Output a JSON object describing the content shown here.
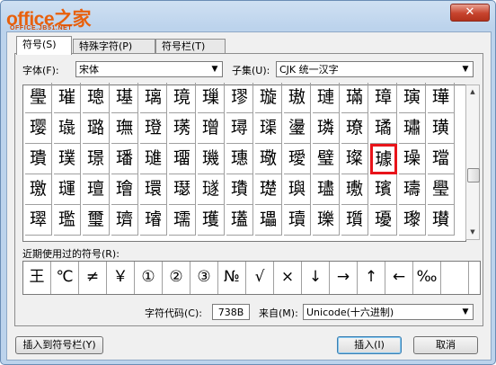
{
  "window": {
    "logo": "office之家",
    "logo_sub": "OFFICE.JB51.NET",
    "close_glyph": "✕"
  },
  "tabs": [
    {
      "label": "符号(S)",
      "active": true
    },
    {
      "label": "特殊字符(P)",
      "active": false
    },
    {
      "label": "符号栏(T)",
      "active": false
    }
  ],
  "font": {
    "label": "字体(F):",
    "value": "宋体"
  },
  "subset": {
    "label": "子集(U):",
    "value": "CJK 统一汉字"
  },
  "grid": {
    "rows": [
      [
        "璺",
        "璀",
        "璁",
        "璂",
        "璃",
        "璄",
        "璅",
        "璆",
        "璇",
        "璈",
        "璉",
        "璊",
        "璋",
        "璌",
        "璍"
      ],
      [
        "璎",
        "璏",
        "璐",
        "璑",
        "璒",
        "璓",
        "璔",
        "璕",
        "璖",
        "璗",
        "璘",
        "璙",
        "璚",
        "璛",
        "璜"
      ],
      [
        "璝",
        "璞",
        "璟",
        "璠",
        "璡",
        "璢",
        "璣",
        "璤",
        "璥",
        "璦",
        "璧",
        "璨",
        "璩",
        "璪",
        "璫"
      ],
      [
        "璬",
        "璭",
        "璮",
        "璯",
        "環",
        "璱",
        "璲",
        "璳",
        "璴",
        "璵",
        "璶",
        "璷",
        "璸",
        "璹",
        "璺"
      ],
      [
        "璻",
        "璼",
        "璽",
        "璾",
        "璿",
        "瓀",
        "瓁",
        "瓂",
        "瓃",
        "瓄",
        "瓅",
        "瓆",
        "瓇",
        "瓈",
        "瓉"
      ]
    ],
    "selected": {
      "row": 2,
      "col": 12
    }
  },
  "recent": {
    "label": "近期使用过的符号(R):",
    "symbols": [
      "王",
      "℃",
      "≠",
      "￥",
      "①",
      "②",
      "③",
      "№",
      "√",
      "×",
      "↓",
      "→",
      "↑",
      "←",
      "‰",
      "",
      ""
    ]
  },
  "charcode": {
    "label": "字符代码(C):",
    "value": "738B"
  },
  "from": {
    "label": "来自(M):",
    "value": "Unicode(十六进制)"
  },
  "buttons": {
    "insert_to_bar": "插入到符号栏(Y)",
    "insert": "插入(I)",
    "cancel": "取消"
  }
}
